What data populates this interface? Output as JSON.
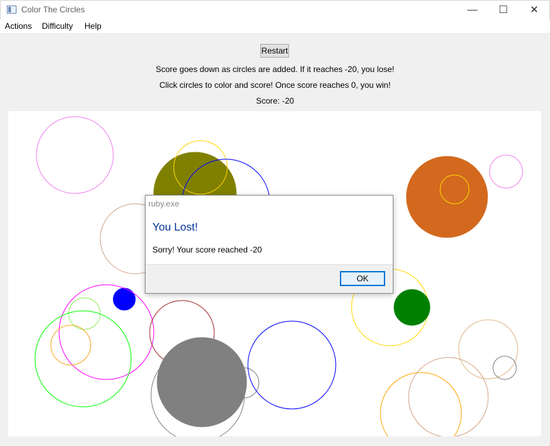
{
  "window": {
    "title": "Color The Circles",
    "minimize_glyph": "—",
    "maximize_glyph": "☐",
    "close_glyph": "✕"
  },
  "menu": {
    "items": [
      "Actions",
      "Difficulty",
      "Help"
    ]
  },
  "game": {
    "restart_label": "Restart",
    "instruction_lose": "Score goes down as circles are added. If it reaches -20, you lose!",
    "instruction_win": "Click circles to color and score! Once score reaches 0, you win!",
    "score_label": "Score:  -20",
    "score_value": -20
  },
  "dialog": {
    "title": "ruby.exe",
    "heading": "You Lost!",
    "message": "Sorry! Your score reached -20",
    "ok_label": "OK"
  },
  "circles": [
    {
      "color": "#ee82ee",
      "filled": false
    },
    {
      "color": "#808000",
      "filled": true
    },
    {
      "color": "#ffd700",
      "filled": false
    },
    {
      "color": "#0000ff",
      "filled": false
    },
    {
      "color": "#d2a387",
      "filled": false
    },
    {
      "color": "#d2691e",
      "filled": true
    },
    {
      "color": "#ffd700",
      "filled": false
    },
    {
      "color": "#ee82ee",
      "filled": false
    },
    {
      "color": "#0000ff",
      "filled": true
    },
    {
      "color": "#ff00ff",
      "filled": false
    },
    {
      "color": "#90ee60",
      "filled": false
    },
    {
      "color": "#00ff00",
      "filled": false
    },
    {
      "color": "#f5a623",
      "filled": false
    },
    {
      "color": "#a52a2a",
      "filled": false
    },
    {
      "color": "#808080",
      "filled": false
    },
    {
      "color": "#808080",
      "filled": true
    },
    {
      "color": "#808080",
      "filled": false
    },
    {
      "color": "#0000ff",
      "filled": false
    },
    {
      "color": "#ffd700",
      "filled": false
    },
    {
      "color": "#008000",
      "filled": true
    },
    {
      "color": "#deb887",
      "filled": false
    },
    {
      "color": "#808080",
      "filled": false
    },
    {
      "color": "#ffa500",
      "filled": false
    },
    {
      "color": "#d2a387",
      "filled": false
    }
  ]
}
